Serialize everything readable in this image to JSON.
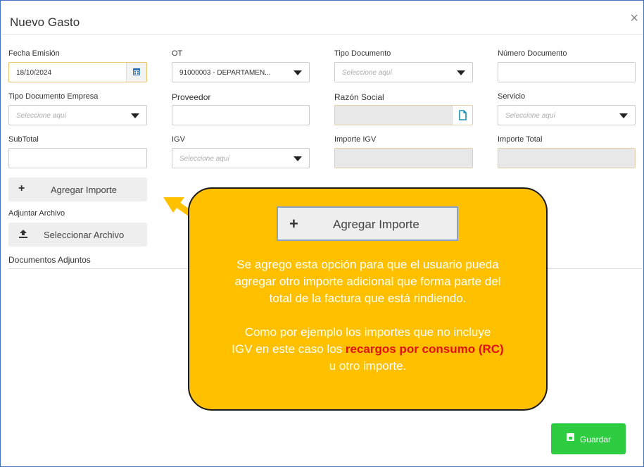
{
  "modal": {
    "title": "Nuevo Gasto",
    "close_glyph": "×"
  },
  "form": {
    "fecha_emision": {
      "label": "Fecha Emisión",
      "value": "18/10/2024",
      "icon": "calendar-icon"
    },
    "ot": {
      "label": "OT",
      "value": "91000003 - DEPARTAMEN..."
    },
    "tipo_documento": {
      "label": "Tipo Documento",
      "placeholder": "Seleccione aquí"
    },
    "numero_documento": {
      "label": "Número Documento",
      "value": ""
    },
    "tipo_documento_empresa": {
      "label": "Tipo Documento Empresa",
      "placeholder": "Seleccione aquí"
    },
    "proveedor": {
      "label": "Proveedor",
      "value": ""
    },
    "razon_social": {
      "label": "Razón Social",
      "value": "",
      "icon": "file-icon"
    },
    "servicio": {
      "label": "Servicio",
      "placeholder": "Seleccione aquí"
    },
    "subtotal": {
      "label": "SubTotal",
      "value": ""
    },
    "igv": {
      "label": "IGV",
      "placeholder": "Seleccione aquí"
    },
    "importe_igv": {
      "label": "Importe IGV",
      "value": ""
    },
    "importe_total": {
      "label": "Importe Total",
      "value": ""
    }
  },
  "buttons": {
    "agregar_importe": {
      "icon": "+",
      "label": "Agregar Importe"
    },
    "adjuntar_label": "Adjuntar Archivo",
    "seleccionar_archivo": {
      "label": "Seleccionar Archivo",
      "icon": "upload-icon"
    },
    "documentos_adjuntos": "Documentos Adjuntos",
    "guardar": {
      "label": "Guardar",
      "icon": "save-icon"
    }
  },
  "callout": {
    "button_icon": "+",
    "button_label": "Agregar Importe",
    "line1": "Se agrego esta opción para que el usuario pueda",
    "line2": "agregar otro importe adicional que forma parte del",
    "line3": "total de la factura que está rindiendo.",
    "line4": "Como por ejemplo los importes que no incluye",
    "line5_pre": "IGV en este caso los ",
    "line5_highlight": "recargos por consumo (RC)",
    "line6": "u otro importe.",
    "colors": {
      "background": "#ffc000",
      "highlight": "#e01010",
      "arrow": "#ffc000"
    }
  },
  "colors": {
    "border": "#4472c4",
    "save_button": "#2ecc40"
  }
}
